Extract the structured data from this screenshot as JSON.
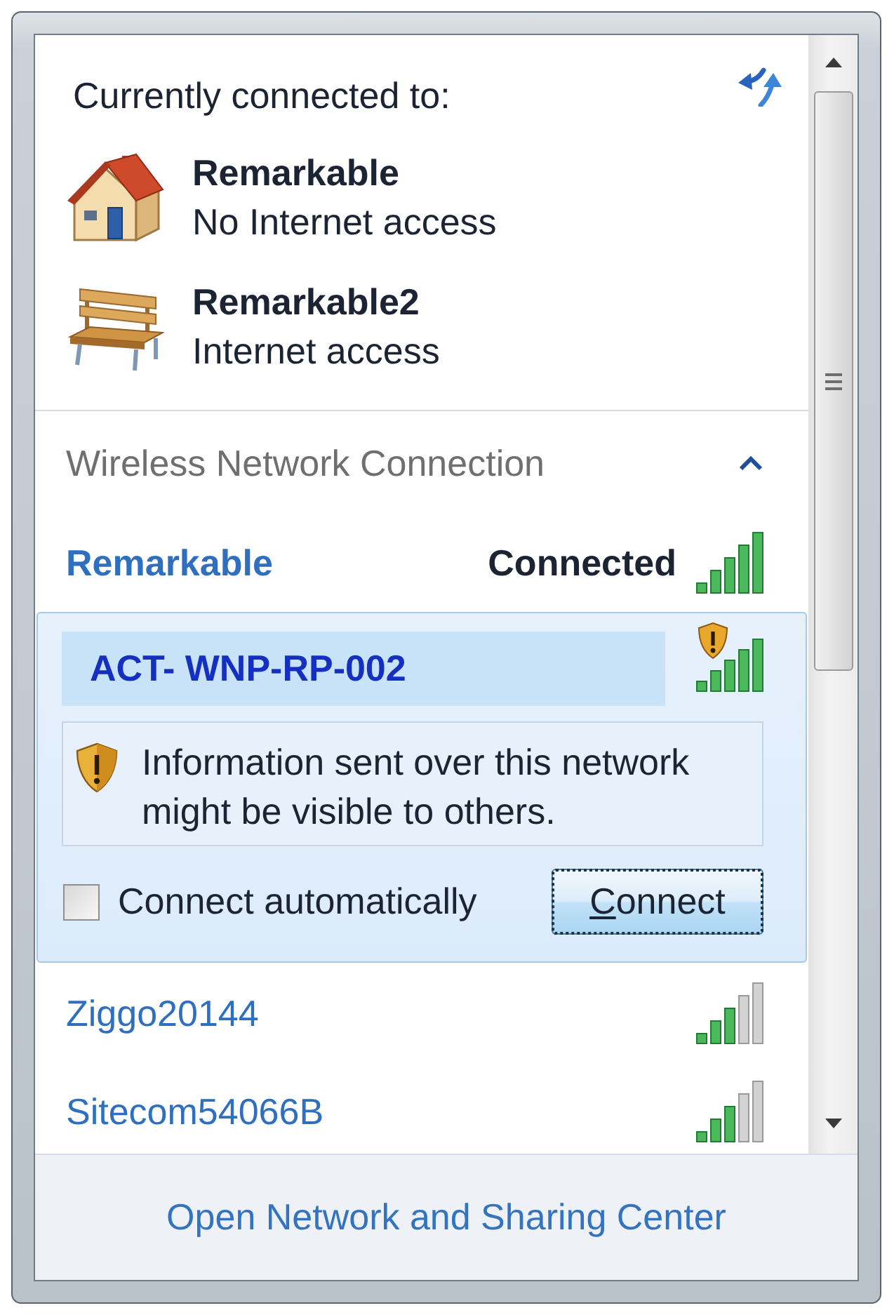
{
  "connected_to": {
    "heading": "Currently connected to:",
    "connections": [
      {
        "kind": "home",
        "name": "Remarkable",
        "status": "No Internet access"
      },
      {
        "kind": "public",
        "name": "Remarkable2",
        "status": "Internet access"
      }
    ]
  },
  "wireless_section": {
    "title": "Wireless Network Connection",
    "expanded": true,
    "networks": [
      {
        "name": "Remarkable",
        "status": "Connected",
        "connected": true,
        "selected": false,
        "expanded": false,
        "full_signal": true,
        "unsecured": false
      },
      {
        "name": "ACT- WNP-RP-002",
        "connected": false,
        "selected": true,
        "expanded": true,
        "full_signal": true,
        "unsecured": true,
        "warning": "Information sent over this network might be visible to others.",
        "connect_automatically": {
          "label": "Connect automatically",
          "checked": false
        },
        "connect_button": {
          "label": "Connect",
          "focused": true,
          "access_key_underlined": true
        }
      },
      {
        "name": "Ziggo20144",
        "connected": false,
        "selected": false,
        "expanded": false,
        "full_signal": false,
        "unsecured": false
      },
      {
        "name": "Sitecom54066B",
        "connected": false,
        "selected": false,
        "expanded": false,
        "full_signal": false,
        "unsecured": false
      }
    ]
  },
  "footer": {
    "link": "Open Network and Sharing Center"
  }
}
